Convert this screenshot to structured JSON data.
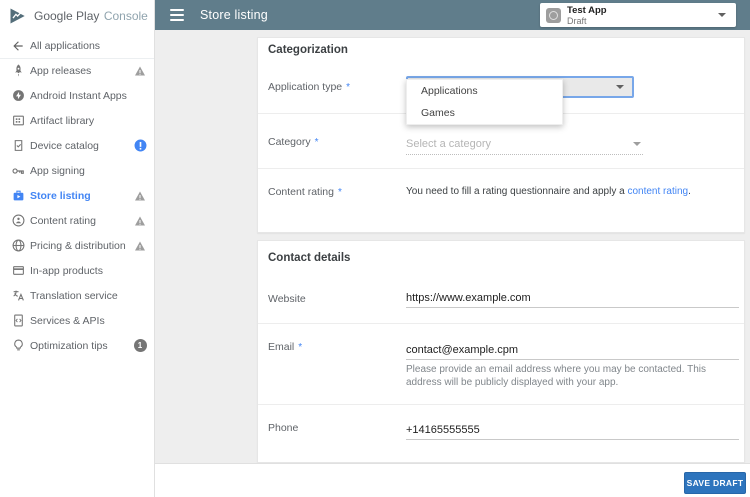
{
  "brand": {
    "google_play": "Google Play",
    "console": "Console"
  },
  "header": {
    "title": "Store listing",
    "app": {
      "name": "Test App",
      "status": "Draft"
    }
  },
  "sidebar": {
    "items": [
      {
        "label": "All applications",
        "icon": "arrow-back"
      },
      {
        "label": "App releases",
        "icon": "rocket",
        "badge": "warning"
      },
      {
        "label": "Android Instant Apps",
        "icon": "instant-bolt"
      },
      {
        "label": "Artifact library",
        "icon": "library-grid"
      },
      {
        "label": "Device catalog",
        "icon": "device-check",
        "badge": "alert-blue"
      },
      {
        "label": "App signing",
        "icon": "key"
      },
      {
        "label": "Store listing",
        "icon": "storefront",
        "badge": "warning",
        "selected": true
      },
      {
        "label": "Content rating",
        "icon": "rating-face",
        "badge": "warning"
      },
      {
        "label": "Pricing & distribution",
        "icon": "globe",
        "badge": "warning"
      },
      {
        "label": "In-app products",
        "icon": "payment-card"
      },
      {
        "label": "Translation service",
        "icon": "translate"
      },
      {
        "label": "Services & APIs",
        "icon": "code-device"
      },
      {
        "label": "Optimization tips",
        "icon": "lightbulb",
        "badge": "count",
        "badge_count": "1"
      }
    ]
  },
  "categorization": {
    "title": "Categorization",
    "application_type": {
      "label": "Application type",
      "required": "*",
      "options": [
        "Applications",
        "Games"
      ]
    },
    "category": {
      "label": "Category",
      "required": "*",
      "placeholder": "Select a category"
    },
    "content_rating": {
      "label": "Content rating",
      "required": "*",
      "text_before": "You need to fill a rating questionnaire and apply a ",
      "link_text": "content rating",
      "text_after": "."
    }
  },
  "contact": {
    "title": "Contact details",
    "website": {
      "label": "Website",
      "value": "https://www.example.com"
    },
    "email": {
      "label": "Email",
      "required": "*",
      "value": "contact@example.cpm",
      "helper": "Please provide an email address where you may be contacted. This address will be publicly displayed with your app."
    },
    "phone": {
      "label": "Phone",
      "value": "+14165555555"
    }
  },
  "footer": {
    "save_label": "SAVE DRAFT"
  },
  "colors": {
    "header_bar": "#607d8b",
    "accent_blue": "#4285f4",
    "save_button": "#2d74bd",
    "warning_gray": "#9e9e9e",
    "background": "#eeeeee"
  }
}
